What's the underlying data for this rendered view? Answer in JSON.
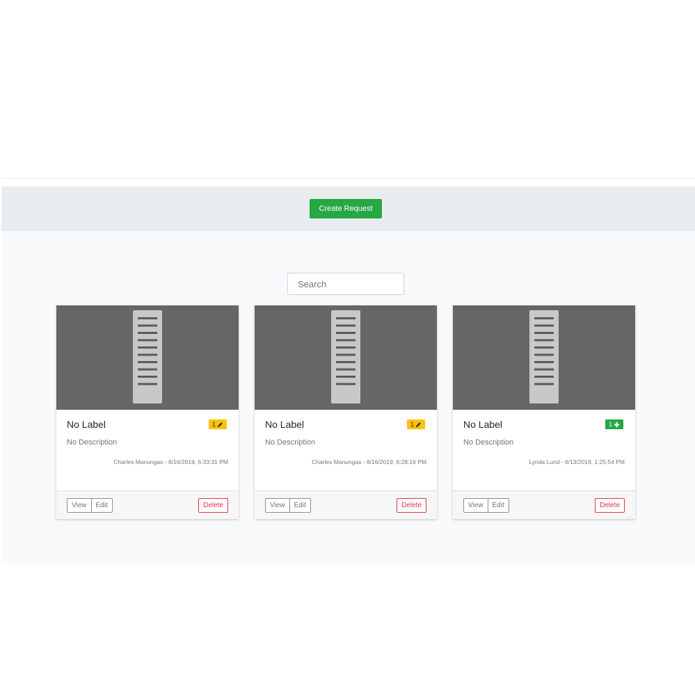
{
  "toolbar": {
    "create_label": "Create Request"
  },
  "search": {
    "placeholder": "Search"
  },
  "cards": [
    {
      "title": "No Label",
      "description": "No Description",
      "meta": "Charles Manungas - 8/16/2019, 6:33:31 PM",
      "badge": {
        "count": "1",
        "icon": "pencil-icon",
        "color": "#ffc107"
      },
      "view_label": "View",
      "edit_label": "Edit",
      "delete_label": "Delete"
    },
    {
      "title": "No Label",
      "description": "No Description",
      "meta": "Charles Manungas - 8/16/2019, 6:28:16 PM",
      "badge": {
        "count": "1",
        "icon": "pencil-icon",
        "color": "#ffc107"
      },
      "view_label": "View",
      "edit_label": "Edit",
      "delete_label": "Delete"
    },
    {
      "title": "No Label",
      "description": "No Description",
      "meta": "Lynda Lund - 6/13/2019, 1:25:54 PM",
      "badge": {
        "count": "1",
        "icon": "plus-icon",
        "color": "#28a745"
      },
      "view_label": "View",
      "edit_label": "Edit",
      "delete_label": "Delete"
    }
  ],
  "colors": {
    "primary_action": "#28a745",
    "danger": "#dc3545",
    "warning": "#ffc107",
    "image_background": "#666666"
  }
}
